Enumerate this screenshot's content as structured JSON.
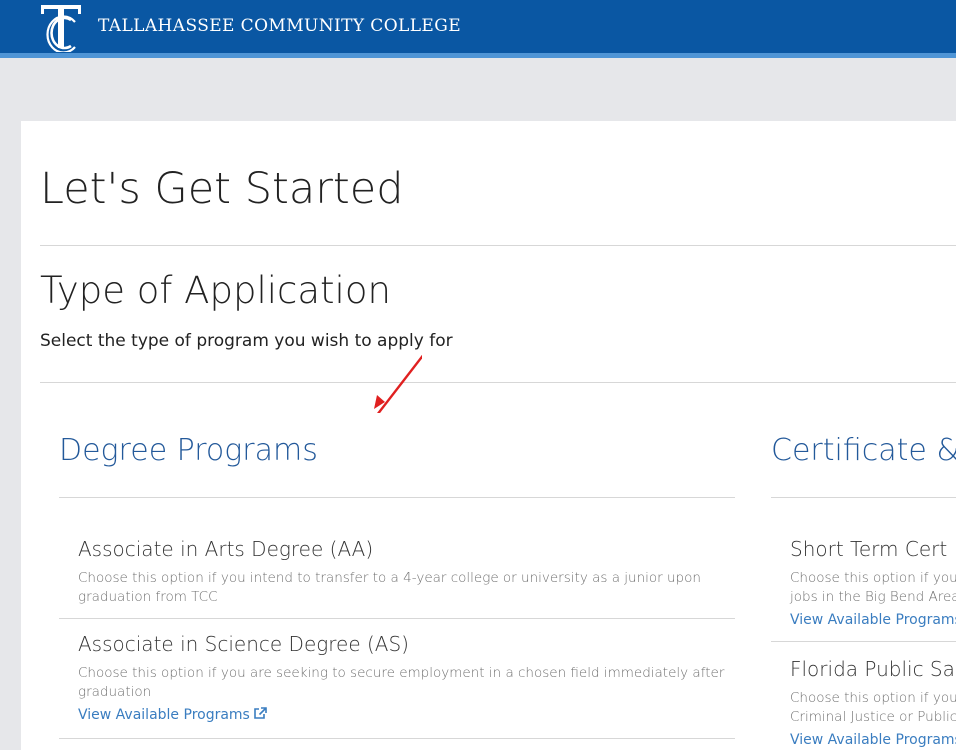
{
  "header": {
    "college_name": "TALLAHASSEE COMMUNITY COLLEGE",
    "logo_icon": "tcc-logo-icon",
    "colors": {
      "bar": "#0a57a3",
      "stripe": "#4f95d6"
    }
  },
  "page": {
    "title": "Let's Get Started",
    "section_title": "Type of Application",
    "section_subtitle": "Select the type of program you wish to apply for"
  },
  "degree": {
    "heading": "Degree Programs",
    "items": [
      {
        "name": "Associate in Arts Degree (AA)",
        "description": "Choose this option if you intend to transfer to a 4-year college or university as a junior upon graduation from TCC"
      },
      {
        "name": "Associate in Science Degree (AS)",
        "description": "Choose this option if you are seeking to secure employment in a chosen field immediately after graduation",
        "link": "View Available Programs",
        "link_icon": "external-link-icon"
      }
    ]
  },
  "certificate": {
    "heading": "Certificate &",
    "items": [
      {
        "name": "Short Term Cert",
        "description_lines": [
          "Choose this option if you",
          "jobs in the Big Bend Area"
        ],
        "link": "View Available Programs"
      },
      {
        "name": "Florida Public Sa",
        "description_lines": [
          "Choose this option if you",
          "Criminal Justice or Public"
        ],
        "link": "View Available Programs"
      }
    ]
  },
  "annotation": {
    "arrow_color": "#e02020"
  }
}
